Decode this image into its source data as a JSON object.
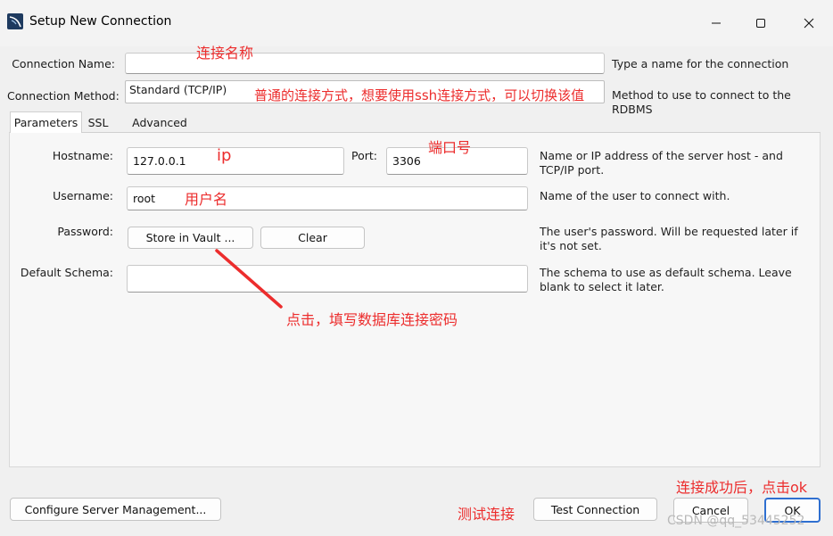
{
  "window": {
    "title": "Setup New Connection",
    "buttons": {
      "minimize": "minimize",
      "maximize": "maximize",
      "close": "close"
    }
  },
  "form": {
    "connection_name": {
      "label": "Connection Name:",
      "value": "",
      "help": "Type a name for the connection"
    },
    "connection_method": {
      "label": "Connection Method:",
      "value": "Standard (TCP/IP)",
      "help": "Method to use to connect to the RDBMS"
    }
  },
  "tabs": [
    {
      "label": "Parameters"
    },
    {
      "label": "SSL"
    },
    {
      "label": "Advanced"
    }
  ],
  "parameters": {
    "hostname": {
      "label": "Hostname:",
      "value": "127.0.0.1"
    },
    "port": {
      "label": "Port:",
      "value": "3306"
    },
    "hostname_help": "Name or IP address of the server host - and TCP/IP port.",
    "username": {
      "label": "Username:",
      "value": "root",
      "help": "Name of the user to connect with."
    },
    "password": {
      "label": "Password:",
      "store_button": "Store in Vault ...",
      "clear_button": "Clear",
      "help": "The user's password. Will be requested later if it's not set."
    },
    "default_schema": {
      "label": "Default Schema:",
      "value": "",
      "help": "The schema to use as default schema. Leave blank to select it later."
    }
  },
  "footer": {
    "configure_button": "Configure Server Management...",
    "test_button": "Test Connection",
    "cancel_button": "Cancel",
    "ok_button": "OK"
  },
  "annotations": {
    "name": "连接名称",
    "method": "普通的连接方式，想要使用ssh连接方式，可以切换该值",
    "ip": "ip",
    "port": "端口号",
    "user": "用户名",
    "password": "点击，填写数据库连接密码",
    "test": "测试连接",
    "ok": "连接成功后，点击ok"
  },
  "watermark": "CSDN @qq_53445252",
  "colors": {
    "annotation": "#ec2d2d",
    "primary_border": "#2f6fd0",
    "icon_blue": "#1e3a5f"
  }
}
